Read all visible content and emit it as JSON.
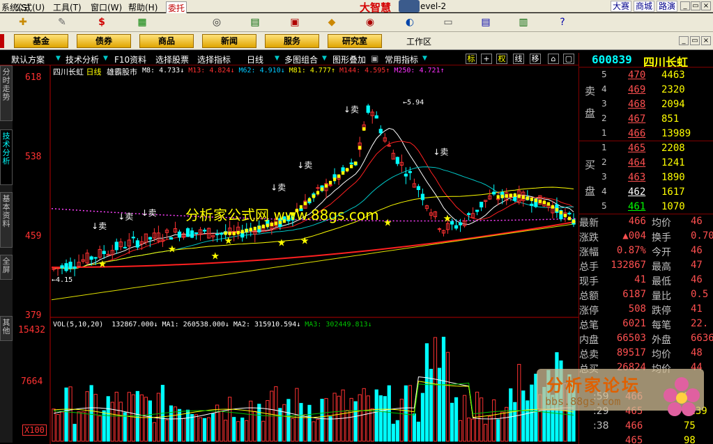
{
  "menu": {
    "items": [
      "系统(S)",
      "公式(U)",
      "工具(T)",
      "窗口(W)",
      "帮助(H)"
    ],
    "delegate_label": "委托",
    "app_title": "大智慧",
    "app_title_suffix": "evel-2",
    "quick_links": [
      "大赛",
      "商城",
      "路演"
    ]
  },
  "categories": [
    "基金",
    "债券",
    "商品",
    "新闻",
    "服务",
    "研究室"
  ],
  "workarea_label": "工作区",
  "left_tabs": [
    {
      "label": "分时走势",
      "active": false
    },
    {
      "label": "技术分析",
      "active": true
    },
    {
      "label": "基本资料",
      "active": false
    },
    {
      "label": "全屏",
      "active": false
    },
    {
      "label": "其他",
      "active": false
    }
  ],
  "funcbar": {
    "items": [
      "默认方案",
      "技术分析",
      "F10资料",
      "选择股票",
      "选择指标",
      "日线",
      "多图组合",
      "图形叠加",
      "常用指标"
    ],
    "toggles": [
      "标",
      "权",
      "线",
      "移"
    ]
  },
  "chart": {
    "title_stock": "四川长虹",
    "title_period": "日线",
    "title_formula": "雄霸股市",
    "ma_lines": [
      {
        "label": "M8:",
        "value": "4.733",
        "arrow": "↓",
        "color": "#ffffff"
      },
      {
        "label": "M13:",
        "value": "4.824",
        "arrow": "↓",
        "color": "#ff3030"
      },
      {
        "label": "M62:",
        "value": "4.910",
        "arrow": "↓",
        "color": "#00c8ff"
      },
      {
        "label": "M81:",
        "value": "4.777",
        "arrow": "↑",
        "color": "#ffff00"
      },
      {
        "label": "M144:",
        "value": "4.595",
        "arrow": "↑",
        "color": "#ff3030"
      },
      {
        "label": "M250:",
        "value": "4.721",
        "arrow": "↑",
        "color": "#ff30ff"
      }
    ],
    "y_axis_labels": [
      "618",
      "538",
      "459",
      "379"
    ],
    "annotations": {
      "high": "5.94",
      "low": "4.15",
      "sell": "卖"
    },
    "vol_axis_labels": [
      "15432",
      "7664",
      "X100"
    ],
    "vol_title": "VOL(5,10,20)",
    "vol_values": [
      {
        "label": "",
        "value": "132867.000",
        "arrow": "↓",
        "color": "#ffffff"
      },
      {
        "label": "MA1:",
        "value": "260538.000",
        "arrow": "↓",
        "color": "#ffffff"
      },
      {
        "label": "MA2:",
        "value": "315910.594",
        "arrow": "↓",
        "color": "#ffffff"
      },
      {
        "label": "MA3:",
        "value": "302449.813",
        "arrow": "↓",
        "color": "#00c000"
      }
    ],
    "watermark_text": "分析家公式网 www.88gs.com"
  },
  "chart_data": {
    "type": "candlestick",
    "title": "四川长虹 日线 雄霸股市",
    "ylim": [
      3.79,
      6.18
    ],
    "y_ticks": [
      6.18,
      5.38,
      4.59,
      3.79
    ],
    "volume_ticks": [
      15432,
      7664
    ],
    "volume_unit": "X100",
    "high_marker": 5.94,
    "low_marker": 4.15,
    "ma_last": {
      "M8": 4.733,
      "M13": 4.824,
      "M62": 4.91,
      "M81": 4.777,
      "M144": 4.595,
      "M250": 4.721
    },
    "vol_last": {
      "VOL": 132867.0,
      "MA1": 260538.0,
      "MA2": 315910.594,
      "MA3": 302449.813
    }
  },
  "quote": {
    "code": "600839",
    "name": "四川长虹",
    "sell_label": [
      "卖",
      "盘"
    ],
    "buy_label": [
      "买",
      "盘"
    ],
    "sell": [
      {
        "level": "5",
        "price": "470",
        "vol": "4463"
      },
      {
        "level": "4",
        "price": "469",
        "vol": "2320"
      },
      {
        "level": "3",
        "price": "468",
        "vol": "2094"
      },
      {
        "level": "2",
        "price": "467",
        "vol": "851"
      },
      {
        "level": "1",
        "price": "466",
        "vol": "13989"
      }
    ],
    "buy": [
      {
        "level": "1",
        "price": "465",
        "vol": "2208",
        "color": "red"
      },
      {
        "level": "2",
        "price": "464",
        "vol": "1241",
        "color": "red"
      },
      {
        "level": "3",
        "price": "463",
        "vol": "1890",
        "color": "red"
      },
      {
        "level": "4",
        "price": "462",
        "vol": "1617",
        "color": "white"
      },
      {
        "level": "5",
        "price": "461",
        "vol": "1070",
        "color": "green"
      }
    ],
    "stats": [
      {
        "l1": "最新",
        "v1": "466",
        "l2": "均价",
        "v2": "46"
      },
      {
        "l1": "涨跌",
        "v1": "▲004",
        "l2": "换手",
        "v2": "0.70"
      },
      {
        "l1": "涨幅",
        "v1": "0.87%",
        "l2": "今开",
        "v2": "46"
      },
      {
        "l1": "总手",
        "v1": "132867",
        "l2": "最高",
        "v2": "47"
      },
      {
        "l1": "现手",
        "v1": "41",
        "l2": "最低",
        "v2": "46"
      },
      {
        "l1": "总额",
        "v1": "6187",
        "l2": "量比",
        "v2": "0.5"
      },
      {
        "l1": "涨停",
        "v1": "508",
        "l2": "跌停",
        "v2": "41"
      },
      {
        "l1": "总笔",
        "v1": "6021",
        "l2": "每笔",
        "v2": "22."
      },
      {
        "l1": "内盘",
        "v1": "66503",
        "l2": "外盘",
        "v2": "6636"
      },
      {
        "l1": "总卖",
        "v1": "89517",
        "l2": "均价",
        "v2": "48"
      },
      {
        "l1": "总买",
        "v1": "26824",
        "l2": "均价",
        "v2": "44"
      }
    ],
    "ticks": [
      {
        "t": ":59",
        "p": "466",
        "v": "51"
      },
      {
        "t": ":29",
        "p": "465",
        "v": "1239"
      },
      {
        "t": ":38",
        "p": "466",
        "v": "75"
      },
      {
        "t": "",
        "p": "465",
        "v": "98"
      }
    ]
  },
  "watermark_forum": {
    "title": "分析家论坛",
    "url": "bbs.88gs.com"
  },
  "colors": {
    "up": "#ff3232",
    "down": "#00ffff",
    "axis": "#b40000",
    "ma_red": "#ff2020",
    "ma_cyan": "#00c8c8",
    "ma_yellow": "#ffff00",
    "ma_pink": "#ff40ff"
  }
}
